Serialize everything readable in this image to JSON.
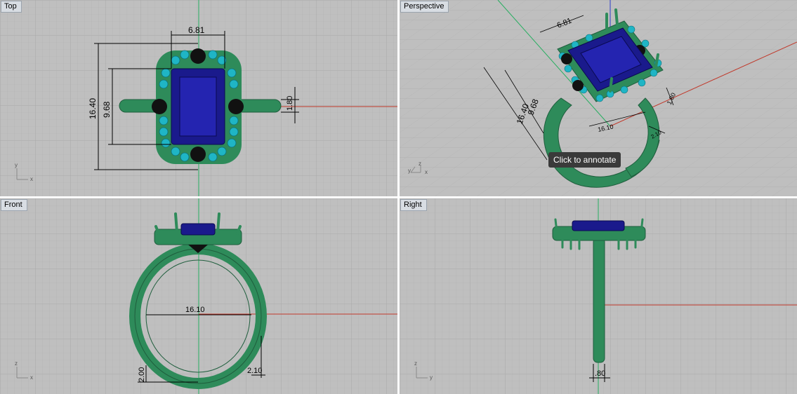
{
  "viewports": {
    "top": {
      "label": "Top",
      "dims": {
        "width": "6.81",
        "length": "16.40",
        "stone": "9.68",
        "band": "1.80"
      }
    },
    "perspective": {
      "label": "Perspective",
      "dims": {
        "width": "6.81",
        "stone": "9.68",
        "length": "16.40",
        "band": "1.80",
        "inner": "16.10",
        "shank": "2.10"
      }
    },
    "front": {
      "label": "Front",
      "dims": {
        "inner": "16.10",
        "bottom": "2.00",
        "shank": "2.10"
      }
    },
    "right": {
      "label": "Right",
      "dims": {
        "thickness": ".80"
      }
    }
  },
  "tooltip": {
    "text": "Click to annotate"
  },
  "axes": {
    "y": "y",
    "x": "x",
    "z": "z"
  },
  "colors": {
    "grid_bg": "#bfbfbf",
    "metal": "#2e8b5a",
    "stone": "#1a1a8c",
    "accent_stones": "#1fb5c5",
    "onyx": "#111111",
    "x_axis": "#c0392b",
    "y_axis": "#27ae60",
    "z_axis": "#2c3ec9"
  }
}
